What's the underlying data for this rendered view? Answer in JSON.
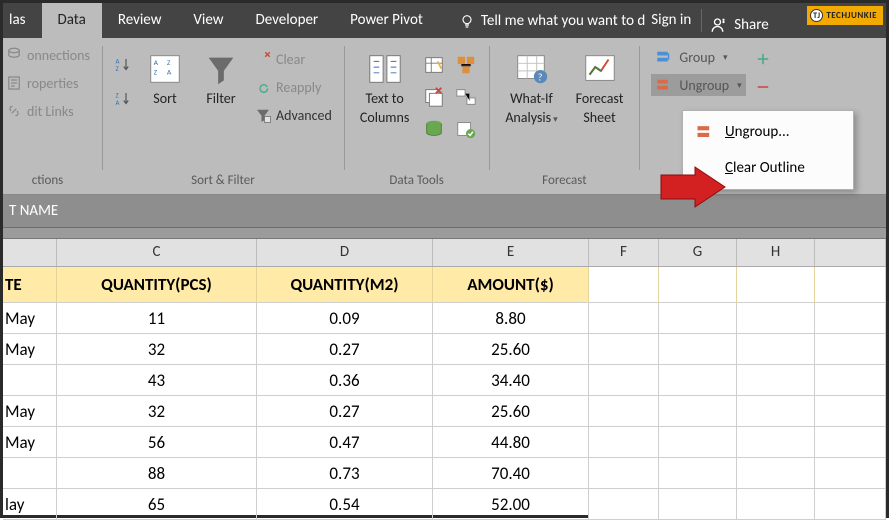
{
  "brand": "TECHJUNKIE",
  "ribbon": {
    "tabs": [
      "las",
      "Data",
      "Review",
      "View",
      "Developer",
      "Power Pivot"
    ],
    "tellme": "Tell me what you want to d",
    "signin": "Sign in",
    "share": "Share"
  },
  "groups": {
    "connections": {
      "label": "ctions",
      "items": [
        "onnections",
        "roperties",
        "dit Links"
      ]
    },
    "sortfilter": {
      "label": "Sort & Filter",
      "sort": "Sort",
      "filter": "Filter",
      "clear": "Clear",
      "reapply": "Reapply",
      "advanced": "Advanced"
    },
    "datatools": {
      "label": "Data Tools",
      "texttocols1": "Text to",
      "texttocols2": "Columns"
    },
    "forecast": {
      "label": "Forecast",
      "whatif1": "What-If",
      "whatif2": "Analysis",
      "fc1": "Forecast",
      "fc2": "Sheet"
    },
    "outline": {
      "group": "Group",
      "ungroup": "Ungroup"
    }
  },
  "dropdown": {
    "ungroup": "Ungroup...",
    "clearoutline": "Clear Outline"
  },
  "subbar": "T NAME",
  "columns": [
    "C",
    "D",
    "E",
    "F",
    "G",
    "H"
  ],
  "table": {
    "headers": [
      "TE",
      "QUANTITY(PCS)",
      "QUANTITY(M2)",
      "AMOUNT($)"
    ],
    "rows": [
      {
        "date": "May",
        "pcs": "11",
        "m2": "0.09",
        "amt": "8.80"
      },
      {
        "date": "May",
        "pcs": "32",
        "m2": "0.27",
        "amt": "25.60"
      },
      {
        "date": "",
        "pcs": "43",
        "m2": "0.36",
        "amt": "34.40"
      },
      {
        "date": "May",
        "pcs": "32",
        "m2": "0.27",
        "amt": "25.60"
      },
      {
        "date": "May",
        "pcs": "56",
        "m2": "0.47",
        "amt": "44.80"
      },
      {
        "date": "",
        "pcs": "88",
        "m2": "0.73",
        "amt": "70.40"
      },
      {
        "date": "lay",
        "pcs": "65",
        "m2": "0.54",
        "amt": "52.00"
      }
    ]
  },
  "chart_data": {
    "type": "table",
    "title": "",
    "columns": [
      "QUANTITY(PCS)",
      "QUANTITY(M2)",
      "AMOUNT($)"
    ],
    "rows": [
      [
        11,
        0.09,
        8.8
      ],
      [
        32,
        0.27,
        25.6
      ],
      [
        43,
        0.36,
        34.4
      ],
      [
        32,
        0.27,
        25.6
      ],
      [
        56,
        0.47,
        44.8
      ],
      [
        88,
        0.73,
        70.4
      ],
      [
        65,
        0.54,
        52.0
      ]
    ]
  }
}
